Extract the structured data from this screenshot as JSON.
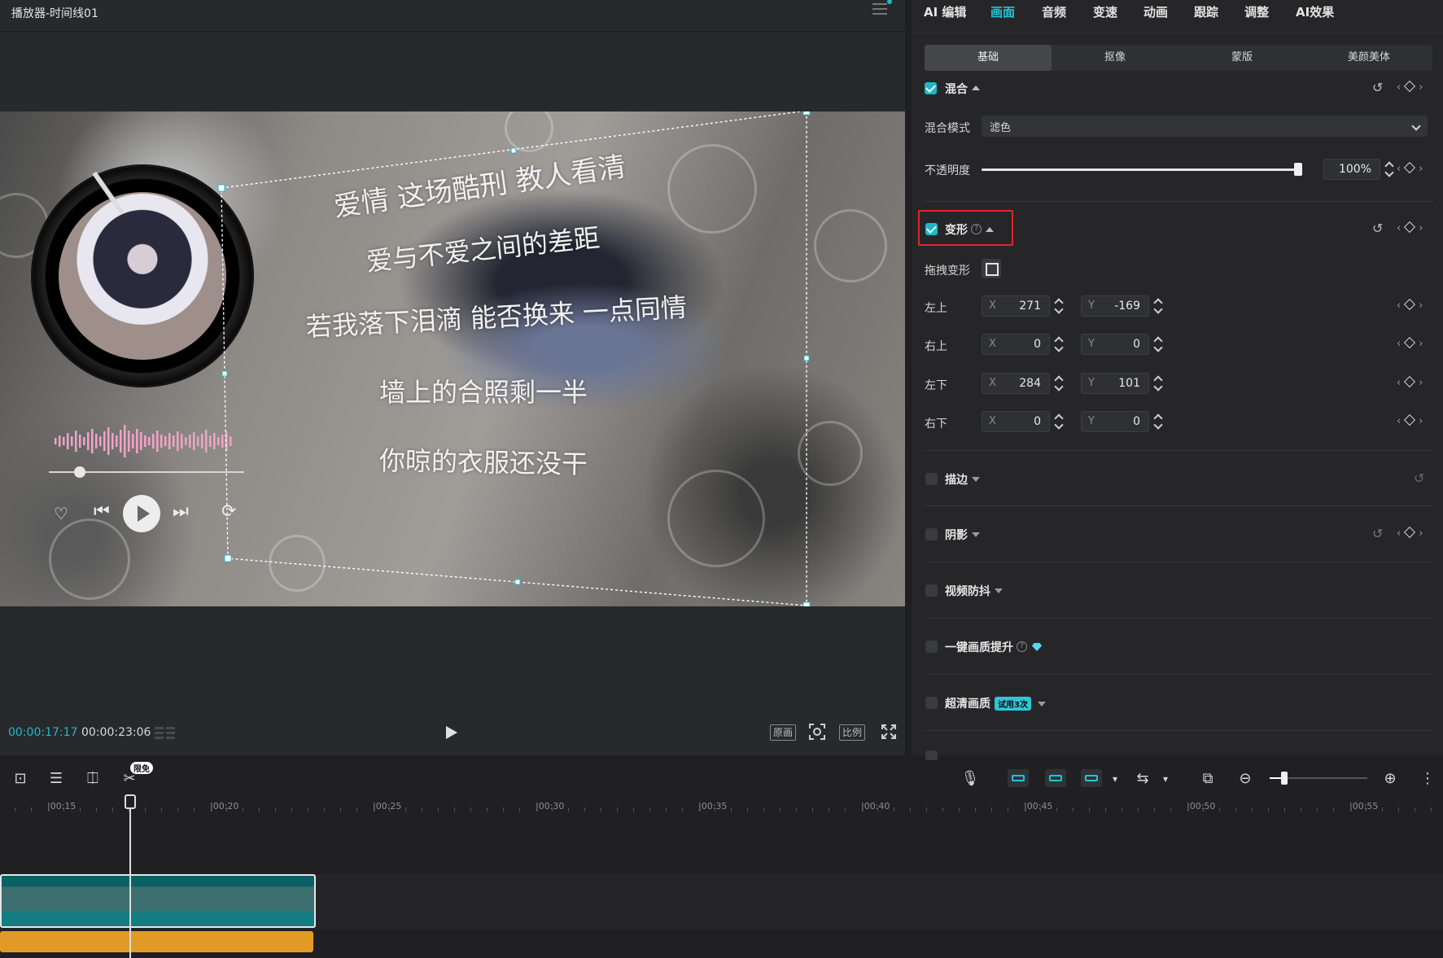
{
  "player": {
    "title": "播放器-时间线01",
    "time_current": "00:00:17:17",
    "time_total": "00:00:23:06",
    "btn_original": "原画",
    "btn_ratio": "比例"
  },
  "lyrics": [
    "爱情 这场酷刑 教人看清",
    "爱与不爱之间的差距",
    "若我落下泪滴 能否换来 一点同情",
    "墙上的合照剩一半",
    "你晾的衣服还没干"
  ],
  "panel": {
    "top_tabs": [
      "AI 编辑",
      "画面",
      "音频",
      "变速",
      "动画",
      "跟踪",
      "调整",
      "AI效果"
    ],
    "active_top_tab": "画面",
    "sub_tabs": [
      "基础",
      "抠像",
      "蒙版",
      "美颜美体"
    ],
    "active_sub_tab": "基础",
    "blend": {
      "label": "混合",
      "mode_label": "混合模式",
      "mode_value": "滤色",
      "opacity_label": "不透明度",
      "opacity_value": "100%",
      "opacity_fraction": 1.0
    },
    "transform": {
      "label": "变形",
      "drag_label": "拖拽变形",
      "corners": [
        {
          "label": "左上",
          "x": "271",
          "y": "-169"
        },
        {
          "label": "右上",
          "x": "0",
          "y": "0"
        },
        {
          "label": "左下",
          "x": "284",
          "y": "101"
        },
        {
          "label": "右下",
          "x": "0",
          "y": "0"
        }
      ]
    },
    "sections": [
      {
        "label": "描边"
      },
      {
        "label": "阴影"
      },
      {
        "label": "视频防抖"
      },
      {
        "label": "一键画质提升"
      },
      {
        "label": "超清画质",
        "badge": "试用3次"
      }
    ]
  },
  "timeline": {
    "limit_badge": "限免",
    "ruler": [
      "|00:15",
      "|00:20",
      "|00:25",
      "|00:30",
      "|00:35",
      "|00:40",
      "|00:45",
      "|00:50",
      "|00:55"
    ]
  },
  "colors": {
    "accent": "#1fb8c8",
    "highlight_box": "#e0262b",
    "audio_clip": "#e29a26",
    "video_clip": "#0b6067"
  }
}
